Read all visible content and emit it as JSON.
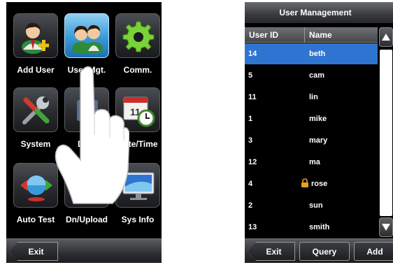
{
  "menu_screen": {
    "tiles": [
      {
        "label": "Add User",
        "icon": "add-user-icon"
      },
      {
        "label": "User Mgt.",
        "icon": "user-mgt-icon"
      },
      {
        "label": "Comm.",
        "icon": "gear-icon"
      },
      {
        "label": "System",
        "icon": "tools-icon"
      },
      {
        "label": "Data",
        "icon": "data-icon"
      },
      {
        "label": "Date/Time",
        "icon": "calendar-clock-icon"
      },
      {
        "label": "Auto Test",
        "icon": "auto-test-icon"
      },
      {
        "label": "Dn/Upload",
        "icon": "usb-icon"
      },
      {
        "label": "Sys Info",
        "icon": "monitor-icon"
      }
    ],
    "selected_tile": "User Mgt.",
    "exit_label": "Exit",
    "overlay": "pointing-hand"
  },
  "user_screen": {
    "title": "User Management",
    "columns": [
      "User ID",
      "Name"
    ],
    "rows": [
      {
        "id": "14",
        "name": "beth",
        "selected": true,
        "locked": false
      },
      {
        "id": "5",
        "name": "cam",
        "selected": false,
        "locked": false
      },
      {
        "id": "11",
        "name": "lin",
        "selected": false,
        "locked": false
      },
      {
        "id": "1",
        "name": "mike",
        "selected": false,
        "locked": false
      },
      {
        "id": "3",
        "name": "mary",
        "selected": false,
        "locked": false
      },
      {
        "id": "12",
        "name": "ma",
        "selected": false,
        "locked": false
      },
      {
        "id": "4",
        "name": "rose",
        "selected": false,
        "locked": true
      },
      {
        "id": "2",
        "name": "sun",
        "selected": false,
        "locked": false
      },
      {
        "id": "13",
        "name": "smith",
        "selected": false,
        "locked": false
      }
    ],
    "buttons": {
      "exit": "Exit",
      "query": "Query",
      "add": "Add"
    }
  },
  "colors": {
    "selected_row": "#2f74d0",
    "selected_tile": "#3a9ad8",
    "screen_bg": "#000000",
    "lock": "#e8a020"
  }
}
